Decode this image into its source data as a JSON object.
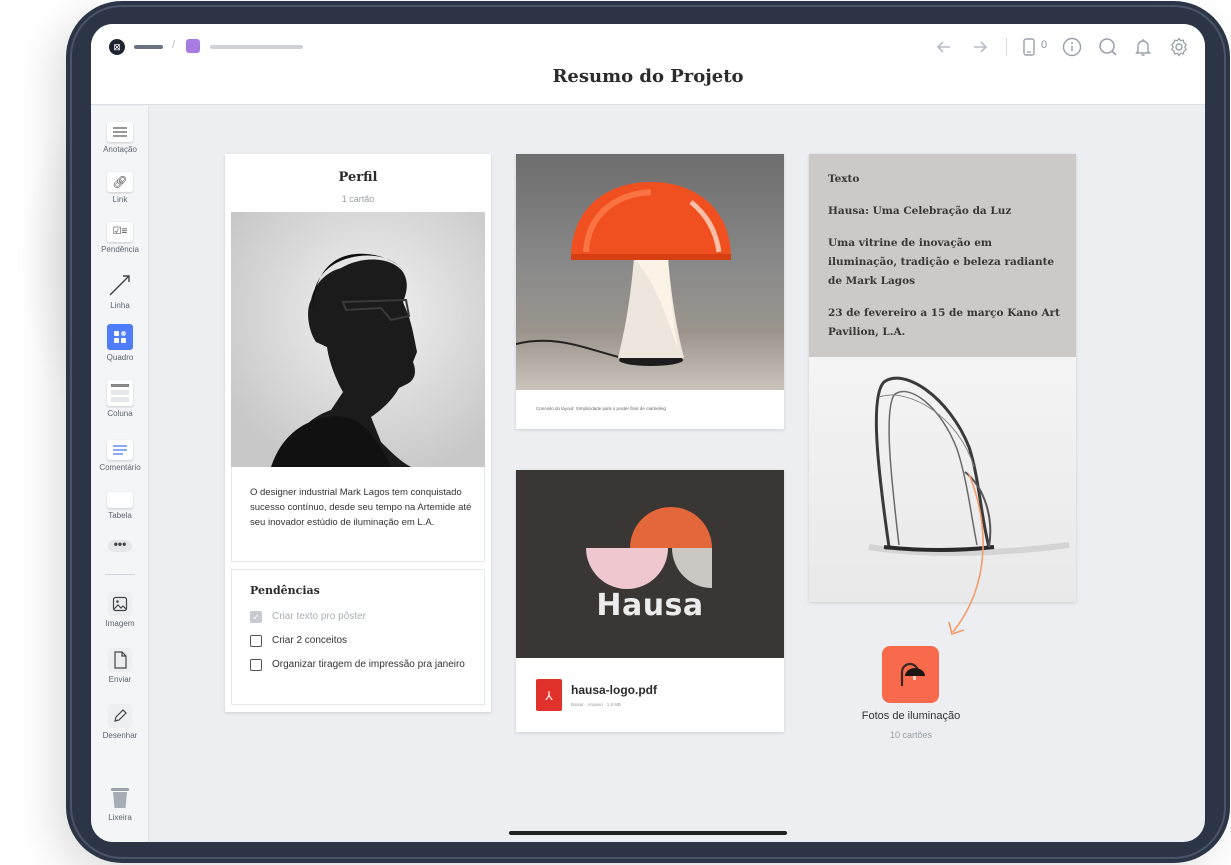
{
  "header": {
    "title": "Resumo do Projeto",
    "device_count": "0",
    "icons": [
      "back-arrow-icon",
      "forward-arrow-icon",
      "device-icon",
      "info-icon",
      "search-icon",
      "bell-icon",
      "gear-icon"
    ]
  },
  "sidebar": {
    "items": [
      {
        "label": "Anotação",
        "icon": "note-icon"
      },
      {
        "label": "Link",
        "icon": "link-icon"
      },
      {
        "label": "Pendência",
        "icon": "todo-icon"
      },
      {
        "label": "Linha",
        "icon": "line-icon"
      },
      {
        "label": "Quadro",
        "icon": "board-icon"
      },
      {
        "label": "Coluna",
        "icon": "column-icon"
      },
      {
        "label": "Comentário",
        "icon": "comment-icon"
      },
      {
        "label": "Tabela",
        "icon": "table-icon"
      },
      {
        "label": "Imagem",
        "icon": "image-icon"
      },
      {
        "label": "Enviar",
        "icon": "upload-icon"
      },
      {
        "label": "Desenhar",
        "icon": "pencil-icon"
      },
      {
        "label": "Lixeira",
        "icon": "trash-icon"
      }
    ],
    "active_color": "#4f7cf7"
  },
  "profile_card": {
    "title": "Perfil",
    "subtitle": "1 cartão",
    "bio": "O designer industrial Mark Lagos tem conquistado sucesso contínuo, desde seu tempo na Artemide até seu inovador estúdio de iluminação em L.A."
  },
  "todo": {
    "title": "Pendências",
    "items": [
      {
        "text": "Criar texto pro pôster",
        "done": true
      },
      {
        "text": "Criar 2 conceitos",
        "done": false
      },
      {
        "text": "Organizar tiragem de impressão pra janeiro",
        "done": false
      }
    ]
  },
  "lamp_card": {
    "caption": "Conceito do layout: Simplicidade para o poster final de marketing"
  },
  "hausa_card": {
    "logo_text": "Hausa",
    "file_name": "hausa-logo.pdf",
    "file_meta": "Baixar · Arquivo · 1,8 MB",
    "colors": {
      "dark": "#3a3634",
      "orange": "#e4663b",
      "pink": "#efc8cf",
      "grey": "#cbc8c4"
    }
  },
  "text_card": {
    "label": "Texto",
    "heading": "Hausa: Uma Celebração da Luz",
    "subheading": "Uma vitrine de inovação em iluminação, tradição e beleza radiante de Mark Lagos",
    "dates": "23 de fevereiro a 15 de março Kano Art Pavilion, L.A."
  },
  "folder": {
    "label": "Fotos de iluminação",
    "count": "10 cartões",
    "color": "#f86a4b",
    "icon": "lamp-icon"
  }
}
